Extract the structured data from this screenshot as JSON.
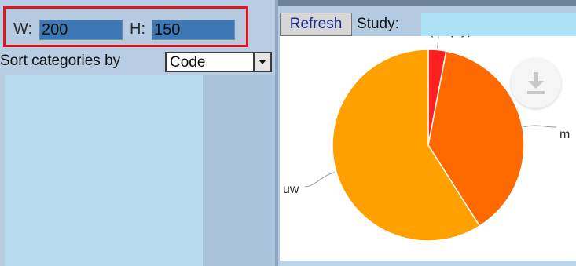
{
  "dimensions": {
    "width_label": "W:",
    "width_value": "200",
    "height_label": "H:",
    "height_value": "150"
  },
  "sort": {
    "label": "Sort categories by",
    "selected": "Code"
  },
  "toolbar": {
    "refresh_label": "Refresh",
    "study_label": "Study:",
    "study_value": ""
  },
  "download_icon": "download-icon",
  "chart_data": {
    "type": "pie",
    "slices": [
      {
        "label": "(empty)",
        "value": 3,
        "color": "#ff1f1f"
      },
      {
        "label": "m",
        "value": 38,
        "color": "#ff6a00"
      },
      {
        "label": "uw",
        "value": 59,
        "color": "#ff9f00"
      }
    ]
  }
}
